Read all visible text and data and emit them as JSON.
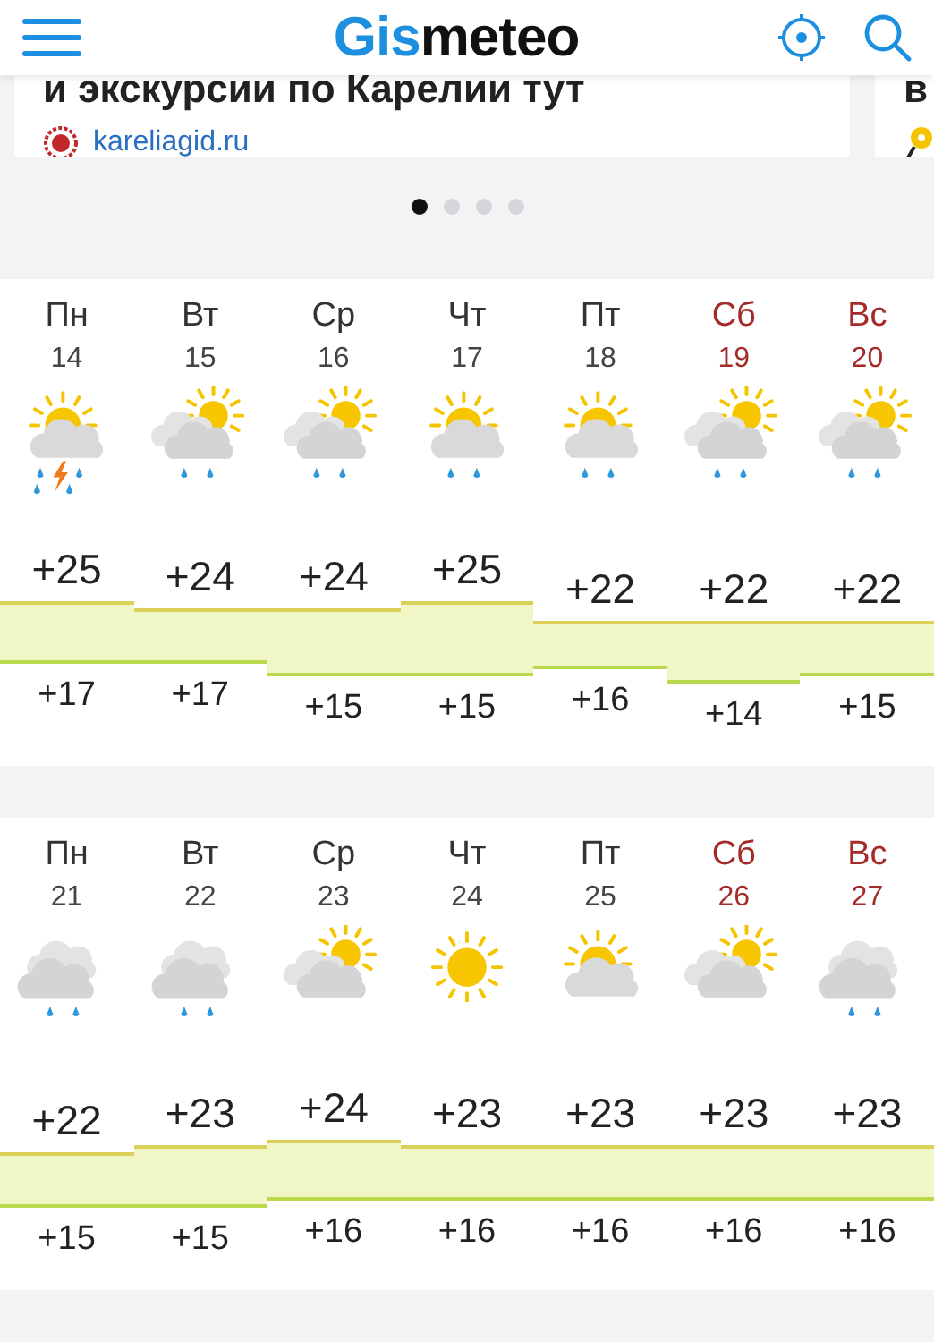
{
  "header": {
    "logo": {
      "accent": "Gis",
      "rest": "meteo"
    }
  },
  "ads": [
    {
      "title": "и экскурсии по Карелии тут",
      "source": "kareliagid.ru"
    },
    {
      "title": "в"
    }
  ],
  "carousel_dots": [
    {
      "selected": true
    },
    {
      "selected": false
    },
    {
      "selected": false
    },
    {
      "selected": false
    }
  ],
  "weeks": [
    {
      "days": [
        {
          "weekday": "Пн",
          "date": "14",
          "weekend": false,
          "kind": "sun_cloud_thunderstorm",
          "max": "+25",
          "min": "+17"
        },
        {
          "weekday": "Вт",
          "date": "15",
          "weekend": false,
          "kind": "cloud_sun_rain",
          "max": "+24",
          "min": "+17"
        },
        {
          "weekday": "Ср",
          "date": "16",
          "weekend": false,
          "kind": "cloud_sun_rain",
          "max": "+24",
          "min": "+15"
        },
        {
          "weekday": "Чт",
          "date": "17",
          "weekend": false,
          "kind": "sun_cloud_rain",
          "max": "+25",
          "min": "+15"
        },
        {
          "weekday": "Пт",
          "date": "18",
          "weekend": false,
          "kind": "sun_cloud_rain",
          "max": "+22",
          "min": "+16"
        },
        {
          "weekday": "Сб",
          "date": "19",
          "weekend": true,
          "kind": "cloud_sun_rain",
          "max": "+22",
          "min": "+14"
        },
        {
          "weekday": "Вс",
          "date": "20",
          "weekend": true,
          "kind": "cloud_sun_rain",
          "max": "+22",
          "min": "+15"
        }
      ]
    },
    {
      "days": [
        {
          "weekday": "Пн",
          "date": "21",
          "weekend": false,
          "kind": "overcast_rain",
          "max": "+22",
          "min": "+15"
        },
        {
          "weekday": "Вт",
          "date": "22",
          "weekend": false,
          "kind": "overcast_rain",
          "max": "+23",
          "min": "+15"
        },
        {
          "weekday": "Ср",
          "date": "23",
          "weekend": false,
          "kind": "cloud_sun",
          "max": "+24",
          "min": "+16"
        },
        {
          "weekday": "Чт",
          "date": "24",
          "weekend": false,
          "kind": "sun",
          "max": "+23",
          "min": "+16"
        },
        {
          "weekday": "Пт",
          "date": "25",
          "weekend": false,
          "kind": "sun_cloud",
          "max": "+23",
          "min": "+16"
        },
        {
          "weekday": "Сб",
          "date": "26",
          "weekend": true,
          "kind": "cloud_sun",
          "max": "+23",
          "min": "+16"
        },
        {
          "weekday": "Вс",
          "date": "27",
          "weekend": true,
          "kind": "overcast_rain",
          "max": "+23",
          "min": "+16"
        }
      ]
    }
  ]
}
